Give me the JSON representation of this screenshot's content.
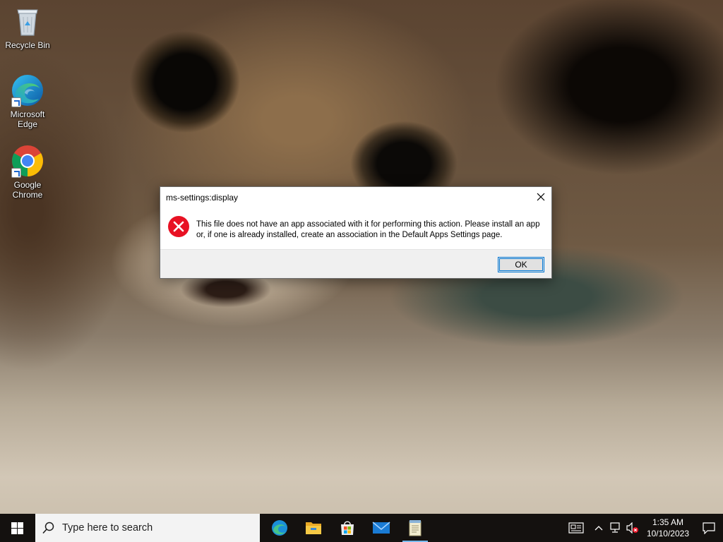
{
  "desktop": {
    "icons": [
      {
        "label": "Recycle Bin",
        "icon": "recycle-bin-icon"
      },
      {
        "label": "Microsoft Edge",
        "icon": "edge-icon"
      },
      {
        "label": "Google Chrome",
        "icon": "chrome-icon"
      }
    ]
  },
  "dialog": {
    "title": "ms-settings:display",
    "icon": "error-icon",
    "message": "This file does not have an app associated with it for performing this action. Please install an app or, if one is already installed, create an association in the Default Apps Settings page.",
    "ok_label": "OK",
    "close_icon": "close-icon"
  },
  "taskbar": {
    "start_icon": "windows-start-icon",
    "search": {
      "placeholder": "Type here to search",
      "icon": "search-icon"
    },
    "pinned": [
      {
        "name": "Microsoft Edge",
        "icon": "edge-icon"
      },
      {
        "name": "File Explorer",
        "icon": "file-explorer-icon"
      },
      {
        "name": "Microsoft Store",
        "icon": "store-icon"
      },
      {
        "name": "Mail",
        "icon": "mail-icon"
      },
      {
        "name": "Notepad",
        "icon": "notepad-icon",
        "active": true
      }
    ],
    "tray": {
      "icons": [
        "news-widget-icon",
        "chevron-up-icon",
        "network-icon",
        "volume-muted-icon"
      ],
      "time": "1:35 AM",
      "date": "10/10/2023",
      "notification_icon": "notification-icon"
    }
  },
  "colors": {
    "accent": "#0078d7",
    "error": "#e81123",
    "taskbar_bg": "#14110f",
    "search_bg": "#f3f3f3",
    "dialog_footer": "#f0f0f0"
  }
}
